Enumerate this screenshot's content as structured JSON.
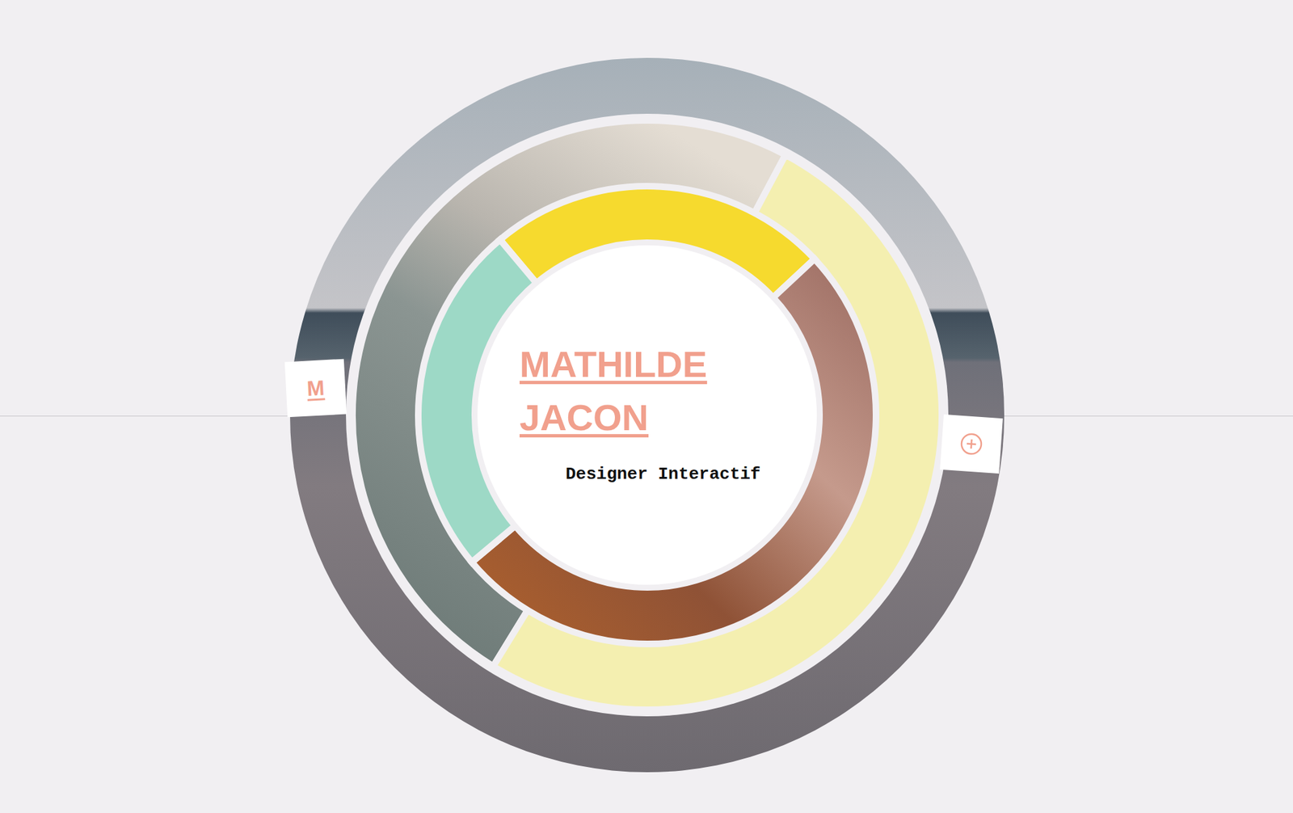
{
  "profile": {
    "name_lines": [
      "MATHILDE",
      "JACON"
    ],
    "role": "Designer Interactif"
  },
  "menu_tab": {
    "label": "M"
  },
  "rings": {
    "middle": [
      {
        "kind": "photo"
      },
      {
        "kind": "color",
        "color": "#f4efb0"
      }
    ],
    "inner": [
      {
        "kind": "color",
        "color": "#f6da2e"
      },
      {
        "kind": "photo"
      },
      {
        "kind": "color",
        "color": "#9dd9c6"
      }
    ]
  }
}
